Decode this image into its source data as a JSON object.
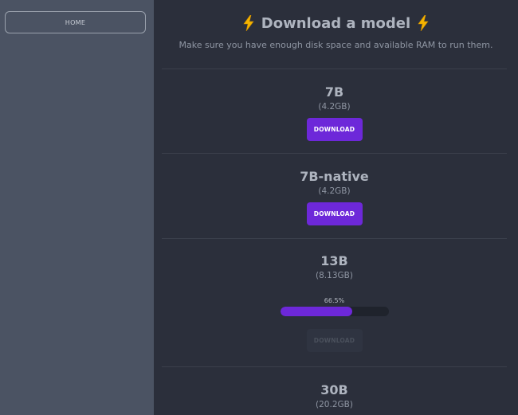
{
  "sidebar": {
    "home_label": "HOME"
  },
  "header": {
    "title": "Download a model",
    "subtitle": "Make sure you have enough disk space and available RAM to run them.",
    "title_icon": "lightning-bolt-emoji"
  },
  "models": [
    {
      "name": "7B",
      "size": "(4.2GB)",
      "button_label": "DOWNLOAD",
      "button_enabled": true
    },
    {
      "name": "7B-native",
      "size": "(4.2GB)",
      "button_label": "DOWNLOAD",
      "button_enabled": true
    },
    {
      "name": "13B",
      "size": "(8.13GB)",
      "button_label": "DOWNLOAD",
      "button_enabled": false,
      "progress_label": "66.5%",
      "progress": 0.665
    },
    {
      "name": "30B",
      "size": "(20.2GB)"
    }
  ],
  "colors": {
    "accent": "#6d28d9",
    "sidebar_bg": "#4b5363",
    "main_bg": "#2b2f3b",
    "bolt": "#f5b400"
  }
}
